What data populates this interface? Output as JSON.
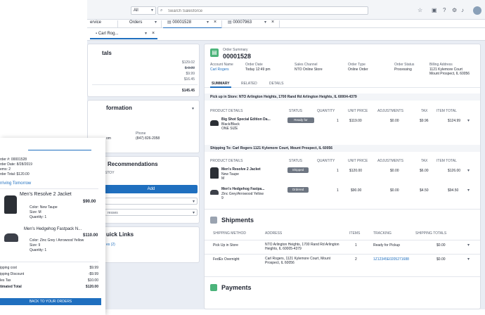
{
  "topbar": {
    "filter_label": "All",
    "search_placeholder": "Search Salesforce"
  },
  "tabs": {
    "service": "ervice",
    "orders": "Orders",
    "order1": "00001528",
    "order2": "00007963",
    "sub_account": "Carl Rog..."
  },
  "left": {
    "totals_title": "tals",
    "totals_values": [
      "$129.02",
      "$-9.99",
      "$9.99",
      "$16.45"
    ],
    "totals_total": "$145.45",
    "information_title": "formation",
    "info_phone_label": "Phone",
    "info_phone_value": "(847) 826-2058",
    "info_email_fragment": "om",
    "recommendations_title": "Recommendations",
    "recommendations_sub": "STOY",
    "add_label": "Add",
    "select1_text": "",
    "select2_text": "resses",
    "quick_links_title": "uick Links",
    "quick_links_item": "es (2)"
  },
  "summary": {
    "type_label": "Order Summary",
    "number": "00001528",
    "fields": [
      {
        "label": "Account Name",
        "value": "Carl Rogers",
        "link": true
      },
      {
        "label": "Order Date",
        "value": "Today 12:49 pm",
        "link": false
      },
      {
        "label": "Sales Channel",
        "value": "NTO Online Store",
        "link": false
      },
      {
        "label": "Order Type",
        "value": "Online Order",
        "link": false
      },
      {
        "label": "Order Status",
        "value": "Processing",
        "link": false
      },
      {
        "label": "Billing Address",
        "value": "1121 Kylemore Court",
        "value2": "Mount Prospect, IL 60056",
        "link": false
      }
    ],
    "tabs": [
      "SUMMARY",
      "RELATED",
      "DETAILS"
    ]
  },
  "pickup": {
    "header_label": "Pick up in Store:",
    "header_value": "NTO Arlington Heights, 1700 Rand Rd Arlington Heights, IL 60004-4379",
    "columns": [
      "PRODUCT DETAILS",
      "STATUS",
      "QUANTITY",
      "UNIT PRICE",
      "ADJUSTMENTS",
      "TAX",
      "ITEM TOTAL"
    ],
    "items": [
      {
        "name": "Big Shot Special Edition Da...",
        "line2": "Black/Black",
        "line3": "ONE SIZE",
        "status": "Ready for Pickup",
        "qty": "1",
        "unit": "$119.00",
        "adj": "$0.00",
        "tax": "$9.96",
        "total": "$124.99"
      }
    ]
  },
  "shipping": {
    "header_label": "Shipping To:",
    "header_value": "Carl Rogers 1121 Kylemore Court, Mount Prospect, IL 60056",
    "columns": [
      "PRODUCT DETAILS",
      "STATUS",
      "QUANTITY",
      "UNIT PRICE",
      "ADJUSTMENTS",
      "TAX",
      "ITEM TOTAL"
    ],
    "items": [
      {
        "name": "Men's Resolve 2 Jacket",
        "line2": "New Taupe",
        "line3": "M",
        "status": "Shipped",
        "qty": "1",
        "unit": "$120.00",
        "adj": "$0.00",
        "tax": "$6.00",
        "total": "$126.00"
      },
      {
        "name": "Men's Hedgehog Fastpa...",
        "line2": "Zinc Grey/Arrowood Yellow",
        "line3": "9",
        "status": "Ordered",
        "qty": "1",
        "unit": "$90.00",
        "adj": "$0.00",
        "tax": "$4.50",
        "total": "$94.50"
      }
    ]
  },
  "shipments": {
    "title": "Shipments",
    "columns": [
      "SHIPPING METHOD",
      "ADDRESS",
      "ITEMS",
      "TRACKING",
      "SHIPPING TOTALS"
    ],
    "rows": [
      {
        "method": "Pick Up in Store",
        "address": "NTO Arlington Heights, 1700 Rand Rd Arlington Heights, IL 60005-4379",
        "items": "1",
        "tracking": "Ready for Pickup",
        "tracking_link": false,
        "total": "$0.00"
      },
      {
        "method": "FedEx Overnight",
        "address": "Carl Rogers, 1121 Kylemore Court, Mount Prospect, IL 60056",
        "items": "2",
        "tracking": "1Z12345E0205271688",
        "tracking_link": true,
        "total": "$0.00"
      }
    ]
  },
  "payments": {
    "title": "Payments"
  },
  "mobile": {
    "order_number": "rder #: 00001528",
    "order_date": "rder Date: 8/28/2019",
    "items": "ems: 2",
    "order_total": "rder Total: $120.00",
    "arriving": "rriving Tomorrow",
    "products": [
      {
        "name": "Men's Resolve 2 Jacket",
        "price": "$90.00",
        "color": "Color: New Taupe",
        "size": "Size: M",
        "qty": "Quantity: 1"
      },
      {
        "name": "Men's Hedgehog Fastpack N...",
        "price": "$110.00",
        "color": "Color: Zinc Grey / Arrowood Yellow",
        "size": "Size: 9",
        "qty": "Quantity: 1"
      }
    ],
    "totals": [
      {
        "label": "ipping cost",
        "value": "$9.99"
      },
      {
        "label": "ipping Discount",
        "value": "-$9.99"
      },
      {
        "label": "les Tax",
        "value": "$10.00"
      },
      {
        "label": "timated Total",
        "value": "$120.00"
      }
    ],
    "back_button": "BACK TO YOUR ORDERS"
  },
  "colors": {
    "accent": "#1f6fbf",
    "badge": "#6e7682",
    "summary_icon": "#4bb37a",
    "jacket": "#2b2f35",
    "shoe": "#3c4049"
  }
}
